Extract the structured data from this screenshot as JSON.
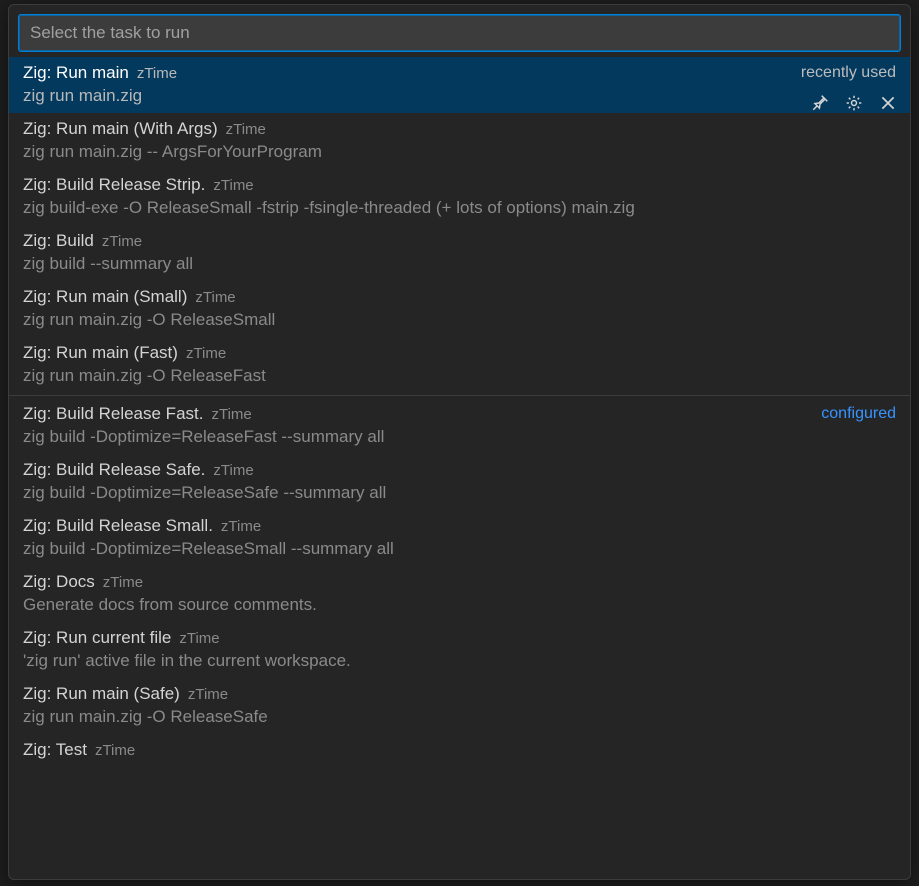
{
  "search": {
    "placeholder": "Select the task to run",
    "value": ""
  },
  "badges": {
    "recent": "recently used",
    "configured": "configured"
  },
  "groups": [
    {
      "badge": "recent",
      "items": [
        {
          "title": "Zig: Run main",
          "source": "zTime",
          "desc": "zig run main.zig",
          "selected": true
        },
        {
          "title": "Zig: Run main (With Args)",
          "source": "zTime",
          "desc": "zig run main.zig -- ArgsForYourProgram"
        },
        {
          "title": "Zig: Build Release Strip.",
          "source": "zTime",
          "desc": "zig build-exe -O ReleaseSmall -fstrip -fsingle-threaded (+ lots of options) main.zig"
        },
        {
          "title": "Zig: Build",
          "source": "zTime",
          "desc": "zig build --summary all"
        },
        {
          "title": "Zig: Run main (Small)",
          "source": "zTime",
          "desc": "zig run main.zig -O ReleaseSmall"
        },
        {
          "title": "Zig: Run main (Fast)",
          "source": "zTime",
          "desc": "zig run main.zig -O ReleaseFast"
        }
      ]
    },
    {
      "badge": "configured",
      "items": [
        {
          "title": "Zig: Build Release Fast.",
          "source": "zTime",
          "desc": "zig build -Doptimize=ReleaseFast --summary all"
        },
        {
          "title": "Zig: Build Release Safe.",
          "source": "zTime",
          "desc": "zig build -Doptimize=ReleaseSafe --summary all"
        },
        {
          "title": "Zig: Build Release Small.",
          "source": "zTime",
          "desc": "zig build -Doptimize=ReleaseSmall --summary all"
        },
        {
          "title": "Zig: Docs",
          "source": "zTime",
          "desc": "Generate docs from source comments."
        },
        {
          "title": "Zig: Run current file",
          "source": "zTime",
          "desc": "'zig run' active file in the current workspace."
        },
        {
          "title": "Zig: Run main (Safe)",
          "source": "zTime",
          "desc": "zig run main.zig -O ReleaseSafe"
        },
        {
          "title": "Zig: Test",
          "source": "zTime",
          "desc": ""
        }
      ]
    }
  ]
}
